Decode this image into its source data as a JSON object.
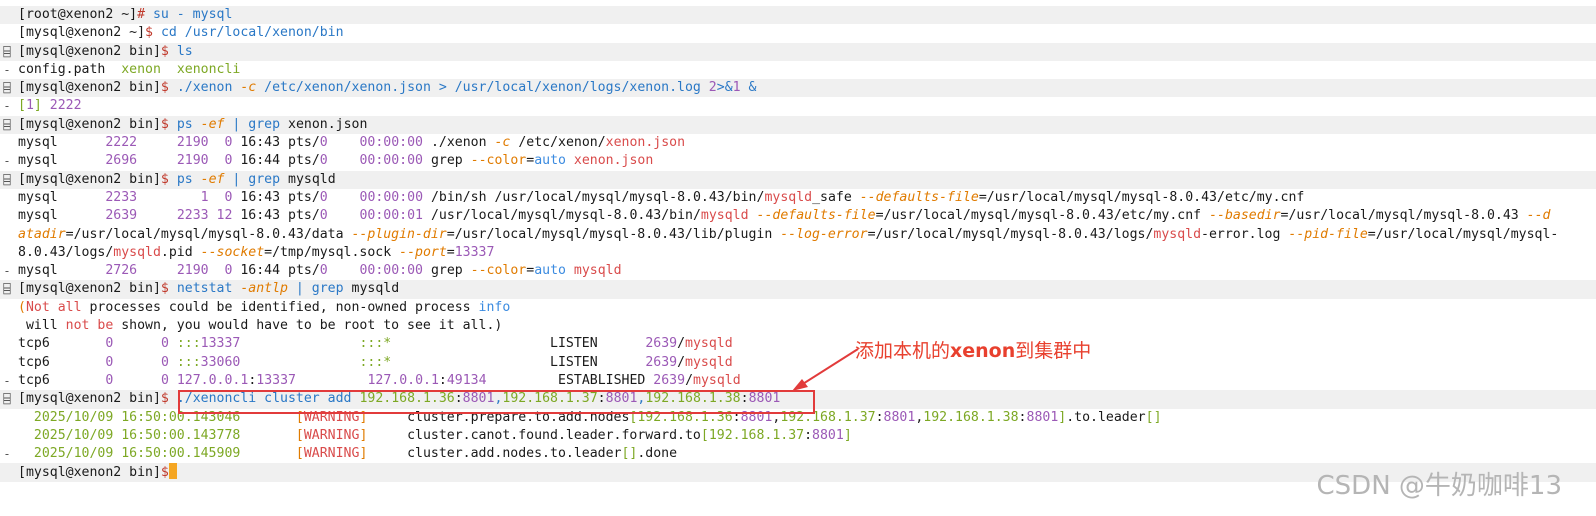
{
  "terminal": {
    "lines": [
      {
        "gutter": "",
        "segments": [
          [
            "c-prompt",
            "[root@xenon2 ~]"
          ],
          [
            "c-dollar",
            "#"
          ],
          [
            "c-cmd",
            " su - mysql"
          ]
        ]
      },
      {
        "gutter": "",
        "segments": [
          [
            "c-prompt",
            "[mysql@xenon2 ~]"
          ],
          [
            "c-dollar",
            "$"
          ],
          [
            "c-cmd",
            " cd /usr/local/xenon/bin"
          ]
        ]
      },
      {
        "gutter": "⌸",
        "segments": [
          [
            "c-prompt",
            "[mysql@xenon2 bin]"
          ],
          [
            "c-dollar",
            "$"
          ],
          [
            "c-cmd",
            " ls"
          ]
        ]
      },
      {
        "gutter": "-",
        "segments": [
          [
            "c-dim",
            "config.path  "
          ],
          [
            "c-green",
            "xenon"
          ],
          [
            "c-dim",
            "  "
          ],
          [
            "c-green",
            "xenoncli"
          ]
        ]
      },
      {
        "gutter": "⌸",
        "segments": [
          [
            "c-prompt",
            "[mysql@xenon2 bin]"
          ],
          [
            "c-dollar",
            "$"
          ],
          [
            "c-cmd",
            " ./xenon "
          ],
          [
            "c-opt",
            "-c"
          ],
          [
            "c-cmd",
            " /etc/xenon/xenon.json > /usr/local/xenon/logs/xenon.log "
          ],
          [
            "c-num",
            "2"
          ],
          [
            "c-cmd",
            ">&"
          ],
          [
            "c-num",
            "1"
          ],
          [
            "c-cmd",
            " &"
          ]
        ]
      },
      {
        "gutter": "-",
        "segments": [
          [
            "c-green",
            "["
          ],
          [
            "c-num",
            "1"
          ],
          [
            "c-green",
            "]"
          ],
          [
            "c-num",
            " 2222"
          ]
        ]
      },
      {
        "gutter": "⌸",
        "segments": [
          [
            "c-prompt",
            "[mysql@xenon2 bin]"
          ],
          [
            "c-dollar",
            "$"
          ],
          [
            "c-cmd",
            " ps "
          ],
          [
            "c-opt",
            "-ef"
          ],
          [
            "c-cmd",
            " | grep "
          ],
          [
            "c-dim",
            "xenon.json"
          ]
        ]
      },
      {
        "gutter": "",
        "segments": [
          [
            "c-dim",
            "mysql      "
          ],
          [
            "c-num",
            "2222"
          ],
          [
            "c-dim",
            "     "
          ],
          [
            "c-num",
            "2190"
          ],
          [
            "c-dim",
            "  "
          ],
          [
            "c-num",
            "0"
          ],
          [
            "c-dim",
            " 16:43 pts/"
          ],
          [
            "c-num",
            "0"
          ],
          [
            "c-dim",
            "    "
          ],
          [
            "c-num",
            "00:00:00"
          ],
          [
            "c-dim",
            " ./xenon "
          ],
          [
            "c-opt",
            "-c"
          ],
          [
            "c-dim",
            " /etc/xenon/"
          ],
          [
            "c-red",
            "xenon.json"
          ]
        ]
      },
      {
        "gutter": "-",
        "segments": [
          [
            "c-dim",
            "mysql      "
          ],
          [
            "c-num",
            "2696"
          ],
          [
            "c-dim",
            "     "
          ],
          [
            "c-num",
            "2190"
          ],
          [
            "c-dim",
            "  "
          ],
          [
            "c-num",
            "0"
          ],
          [
            "c-dim",
            " 16:44 pts/"
          ],
          [
            "c-num",
            "0"
          ],
          [
            "c-dim",
            "    "
          ],
          [
            "c-num",
            "00:00:00"
          ],
          [
            "c-dim",
            " grep "
          ],
          [
            "c-orange",
            "--color"
          ],
          [
            "c-dim",
            "="
          ],
          [
            "c-blue",
            "auto"
          ],
          [
            "c-dim",
            " "
          ],
          [
            "c-red",
            "xenon.json"
          ]
        ]
      },
      {
        "gutter": "⌸",
        "segments": [
          [
            "c-prompt",
            "[mysql@xenon2 bin]"
          ],
          [
            "c-dollar",
            "$"
          ],
          [
            "c-cmd",
            " ps "
          ],
          [
            "c-opt",
            "-ef"
          ],
          [
            "c-cmd",
            " | grep "
          ],
          [
            "c-dim",
            "mysqld"
          ]
        ]
      },
      {
        "gutter": "",
        "segments": [
          [
            "c-dim",
            "mysql      "
          ],
          [
            "c-num",
            "2233"
          ],
          [
            "c-dim",
            "        "
          ],
          [
            "c-num",
            "1"
          ],
          [
            "c-dim",
            "  "
          ],
          [
            "c-num",
            "0"
          ],
          [
            "c-dim",
            " 16:43 pts/"
          ],
          [
            "c-num",
            "0"
          ],
          [
            "c-dim",
            "    "
          ],
          [
            "c-num",
            "00:00:00"
          ],
          [
            "c-dim",
            " /bin/sh /usr/local/mysql/mysql-8.0.43/bin/"
          ],
          [
            "c-red",
            "mysqld"
          ],
          [
            "c-dim",
            "_safe "
          ],
          [
            "c-opt",
            "--defaults-file"
          ],
          [
            "c-dim",
            "=/usr/local/mysql/mysql-8.0.43/etc/my.cnf"
          ]
        ]
      },
      {
        "gutter": "",
        "segments": [
          [
            "c-dim",
            "mysql      "
          ],
          [
            "c-num",
            "2639"
          ],
          [
            "c-dim",
            "     "
          ],
          [
            "c-num",
            "2233"
          ],
          [
            "c-dim",
            " "
          ],
          [
            "c-num",
            "12"
          ],
          [
            "c-dim",
            " 16:43 pts/"
          ],
          [
            "c-num",
            "0"
          ],
          [
            "c-dim",
            "    "
          ],
          [
            "c-num",
            "00:00:01"
          ],
          [
            "c-dim",
            " /usr/local/mysql/mysql-8.0.43/bin/"
          ],
          [
            "c-red",
            "mysqld"
          ],
          [
            "c-dim",
            " "
          ],
          [
            "c-opt",
            "--defaults-file"
          ],
          [
            "c-dim",
            "=/usr/local/mysql/mysql-8.0.43/etc/my.cnf "
          ],
          [
            "c-opt",
            "--basedir"
          ],
          [
            "c-dim",
            "=/usr/local/mysql/mysql-8.0.43 "
          ],
          [
            "c-opt",
            "--d"
          ]
        ]
      },
      {
        "gutter": "",
        "segments": [
          [
            "c-opt",
            "atadir"
          ],
          [
            "c-dim",
            "=/usr/local/mysql/mysql-8.0.43/data "
          ],
          [
            "c-opt",
            "--plugin-dir"
          ],
          [
            "c-dim",
            "=/usr/local/mysql/mysql-8.0.43/lib/plugin "
          ],
          [
            "c-opt",
            "--log-error"
          ],
          [
            "c-dim",
            "=/usr/local/mysql/mysql-8.0.43/logs/"
          ],
          [
            "c-red",
            "mysqld"
          ],
          [
            "c-dim",
            "-error.log "
          ],
          [
            "c-opt",
            "--pid-file"
          ],
          [
            "c-dim",
            "=/usr/local/mysql/mysql-"
          ]
        ]
      },
      {
        "gutter": "",
        "segments": [
          [
            "c-dim",
            "8.0.43/logs/"
          ],
          [
            "c-red",
            "mysqld"
          ],
          [
            "c-dim",
            ".pid "
          ],
          [
            "c-opt",
            "--socket"
          ],
          [
            "c-dim",
            "=/tmp/mysql.sock "
          ],
          [
            "c-opt",
            "--port"
          ],
          [
            "c-dim",
            "="
          ],
          [
            "c-num",
            "13337"
          ]
        ]
      },
      {
        "gutter": "-",
        "segments": [
          [
            "c-dim",
            "mysql      "
          ],
          [
            "c-num",
            "2726"
          ],
          [
            "c-dim",
            "     "
          ],
          [
            "c-num",
            "2190"
          ],
          [
            "c-dim",
            "  "
          ],
          [
            "c-num",
            "0"
          ],
          [
            "c-dim",
            " 16:44 pts/"
          ],
          [
            "c-num",
            "0"
          ],
          [
            "c-dim",
            "    "
          ],
          [
            "c-num",
            "00:00:00"
          ],
          [
            "c-dim",
            " grep "
          ],
          [
            "c-orange",
            "--color"
          ],
          [
            "c-dim",
            "="
          ],
          [
            "c-blue",
            "auto"
          ],
          [
            "c-dim",
            " "
          ],
          [
            "c-red",
            "mysqld"
          ]
        ]
      },
      {
        "gutter": "⌸",
        "segments": [
          [
            "c-prompt",
            "[mysql@xenon2 bin]"
          ],
          [
            "c-dollar",
            "$"
          ],
          [
            "c-cmd",
            " netstat "
          ],
          [
            "c-opt",
            "-antlp"
          ],
          [
            "c-cmd",
            " | grep "
          ],
          [
            "c-dim",
            "mysqld"
          ]
        ]
      },
      {
        "gutter": "",
        "segments": [
          [
            "c-orange",
            "("
          ],
          [
            "c-red",
            "Not all"
          ],
          [
            "c-dim",
            " processes could be identified, non-owned process "
          ],
          [
            "c-blue",
            "info"
          ]
        ]
      },
      {
        "gutter": "",
        "segments": [
          [
            "c-dim",
            " will "
          ],
          [
            "c-red",
            "not be"
          ],
          [
            "c-dim",
            " shown, you would have to be root to see it all.)"
          ]
        ]
      },
      {
        "gutter": "",
        "segments": [
          [
            "c-dim",
            "tcp6       "
          ],
          [
            "c-num",
            "0"
          ],
          [
            "c-dim",
            "      "
          ],
          [
            "c-num",
            "0"
          ],
          [
            "c-dim",
            " "
          ],
          [
            "c-green",
            ":::"
          ],
          [
            "c-num",
            "13337"
          ],
          [
            "c-dim",
            "               "
          ],
          [
            "c-green",
            ":::*"
          ],
          [
            "c-dim",
            "                    LISTEN      "
          ],
          [
            "c-num",
            "2639"
          ],
          [
            "c-dim",
            "/"
          ],
          [
            "c-red",
            "mysqld"
          ]
        ]
      },
      {
        "gutter": "",
        "segments": [
          [
            "c-dim",
            "tcp6       "
          ],
          [
            "c-num",
            "0"
          ],
          [
            "c-dim",
            "      "
          ],
          [
            "c-num",
            "0"
          ],
          [
            "c-dim",
            " "
          ],
          [
            "c-green",
            ":::"
          ],
          [
            "c-num",
            "33060"
          ],
          [
            "c-dim",
            "               "
          ],
          [
            "c-green",
            ":::*"
          ],
          [
            "c-dim",
            "                    LISTEN      "
          ],
          [
            "c-num",
            "2639"
          ],
          [
            "c-dim",
            "/"
          ],
          [
            "c-red",
            "mysqld"
          ]
        ]
      },
      {
        "gutter": "-",
        "segments": [
          [
            "c-dim",
            "tcp6       "
          ],
          [
            "c-num",
            "0"
          ],
          [
            "c-dim",
            "      "
          ],
          [
            "c-num",
            "0"
          ],
          [
            "c-dim",
            " "
          ],
          [
            "c-num",
            "127.0.0.1"
          ],
          [
            "c-dim",
            ":"
          ],
          [
            "c-num",
            "13337"
          ],
          [
            "c-dim",
            "         "
          ],
          [
            "c-num",
            "127.0.0.1"
          ],
          [
            "c-dim",
            ":"
          ],
          [
            "c-num",
            "49134"
          ],
          [
            "c-dim",
            "         ESTABLISHED "
          ],
          [
            "c-num",
            "2639"
          ],
          [
            "c-dim",
            "/"
          ],
          [
            "c-red",
            "mysqld"
          ]
        ]
      },
      {
        "gutter": "⌸",
        "segments": [
          [
            "c-prompt",
            "[mysql@xenon2 bin]"
          ],
          [
            "c-dollar",
            "$"
          ],
          [
            "c-cmd",
            " ./xenoncli cluster add "
          ],
          [
            "c-green",
            "192.168.1.36"
          ],
          [
            "c-dim",
            ":"
          ],
          [
            "c-num",
            "8801"
          ],
          [
            "c-cmd",
            ","
          ],
          [
            "c-green",
            "192.168.1.37"
          ],
          [
            "c-dim",
            ":"
          ],
          [
            "c-num",
            "8801"
          ],
          [
            "c-cmd",
            ","
          ],
          [
            "c-green",
            "192.168.1.38"
          ],
          [
            "c-dim",
            ":"
          ],
          [
            "c-num",
            "8801"
          ]
        ]
      },
      {
        "gutter": "",
        "segments": [
          [
            "c-dim",
            "  "
          ],
          [
            "c-green",
            "2025/10/09 16:50:00.143046"
          ],
          [
            "c-dim",
            "       "
          ],
          [
            "c-orange",
            "["
          ],
          [
            "c-red",
            "WARNING"
          ],
          [
            "c-orange",
            "]"
          ],
          [
            "c-dim",
            "     cluster.prepare.to.add.nodes"
          ],
          [
            "c-green",
            "["
          ],
          [
            "c-green",
            "192.168.1.36"
          ],
          [
            "c-dim",
            ":"
          ],
          [
            "c-num",
            "8801"
          ],
          [
            "c-dim",
            ","
          ],
          [
            "c-green",
            "192.168.1.37"
          ],
          [
            "c-dim",
            ":"
          ],
          [
            "c-num",
            "8801"
          ],
          [
            "c-dim",
            ","
          ],
          [
            "c-green",
            "192.168.1.38"
          ],
          [
            "c-dim",
            ":"
          ],
          [
            "c-num",
            "8801"
          ],
          [
            "c-green",
            "]"
          ],
          [
            "c-dim",
            ".to.leader"
          ],
          [
            "c-green",
            "[]"
          ]
        ]
      },
      {
        "gutter": "",
        "segments": [
          [
            "c-dim",
            "  "
          ],
          [
            "c-green",
            "2025/10/09 16:50:00.143778"
          ],
          [
            "c-dim",
            "       "
          ],
          [
            "c-orange",
            "["
          ],
          [
            "c-red",
            "WARNING"
          ],
          [
            "c-orange",
            "]"
          ],
          [
            "c-dim",
            "     cluster.canot.found.leader.forward.to"
          ],
          [
            "c-green",
            "["
          ],
          [
            "c-green",
            "192.168.1.37"
          ],
          [
            "c-dim",
            ":"
          ],
          [
            "c-num",
            "8801"
          ],
          [
            "c-green",
            "]"
          ]
        ]
      },
      {
        "gutter": "-",
        "segments": [
          [
            "c-dim",
            "  "
          ],
          [
            "c-green",
            "2025/10/09 16:50:00.145909"
          ],
          [
            "c-dim",
            "       "
          ],
          [
            "c-orange",
            "["
          ],
          [
            "c-red",
            "WARNING"
          ],
          [
            "c-orange",
            "]"
          ],
          [
            "c-dim",
            "     cluster.add.nodes.to.leader"
          ],
          [
            "c-green",
            "[]"
          ],
          [
            "c-dim",
            ".done"
          ]
        ]
      },
      {
        "gutter": "",
        "segments": [
          [
            "c-prompt",
            "[mysql@xenon2 bin]"
          ],
          [
            "c-dollar",
            "$"
          ]
        ],
        "cursor": true
      }
    ]
  },
  "annotation": {
    "text_before": "添加本机的",
    "text_bold": "xenon",
    "text_after": "到集群中",
    "color": "#e8402e"
  },
  "watermark": "CSDN @牛奶咖啡13"
}
